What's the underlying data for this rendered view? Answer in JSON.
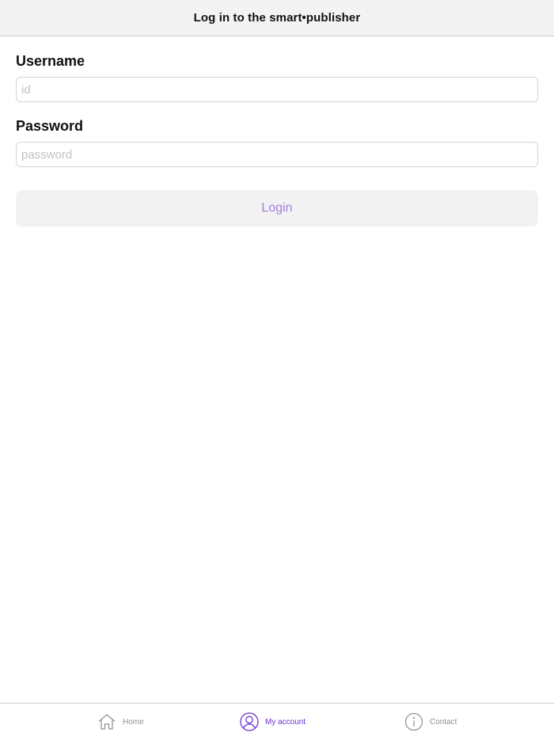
{
  "nav": {
    "title": "Log in to the smart•publisher"
  },
  "form": {
    "username_label": "Username",
    "username_placeholder": "id",
    "username_value": "",
    "password_label": "Password",
    "password_placeholder": "password",
    "password_value": "",
    "login_label": "Login"
  },
  "tabs": [
    {
      "label": "Home",
      "icon": "home-icon",
      "active": false
    },
    {
      "label": "My account",
      "icon": "user-circle-icon",
      "active": true
    },
    {
      "label": "Contact",
      "icon": "info-icon",
      "active": false
    }
  ],
  "colors": {
    "accent": "#6d2fd0",
    "button_text": "#a27ce0",
    "nav_background": "#f3f3f3",
    "inactive_tab": "#8e8e8e"
  }
}
